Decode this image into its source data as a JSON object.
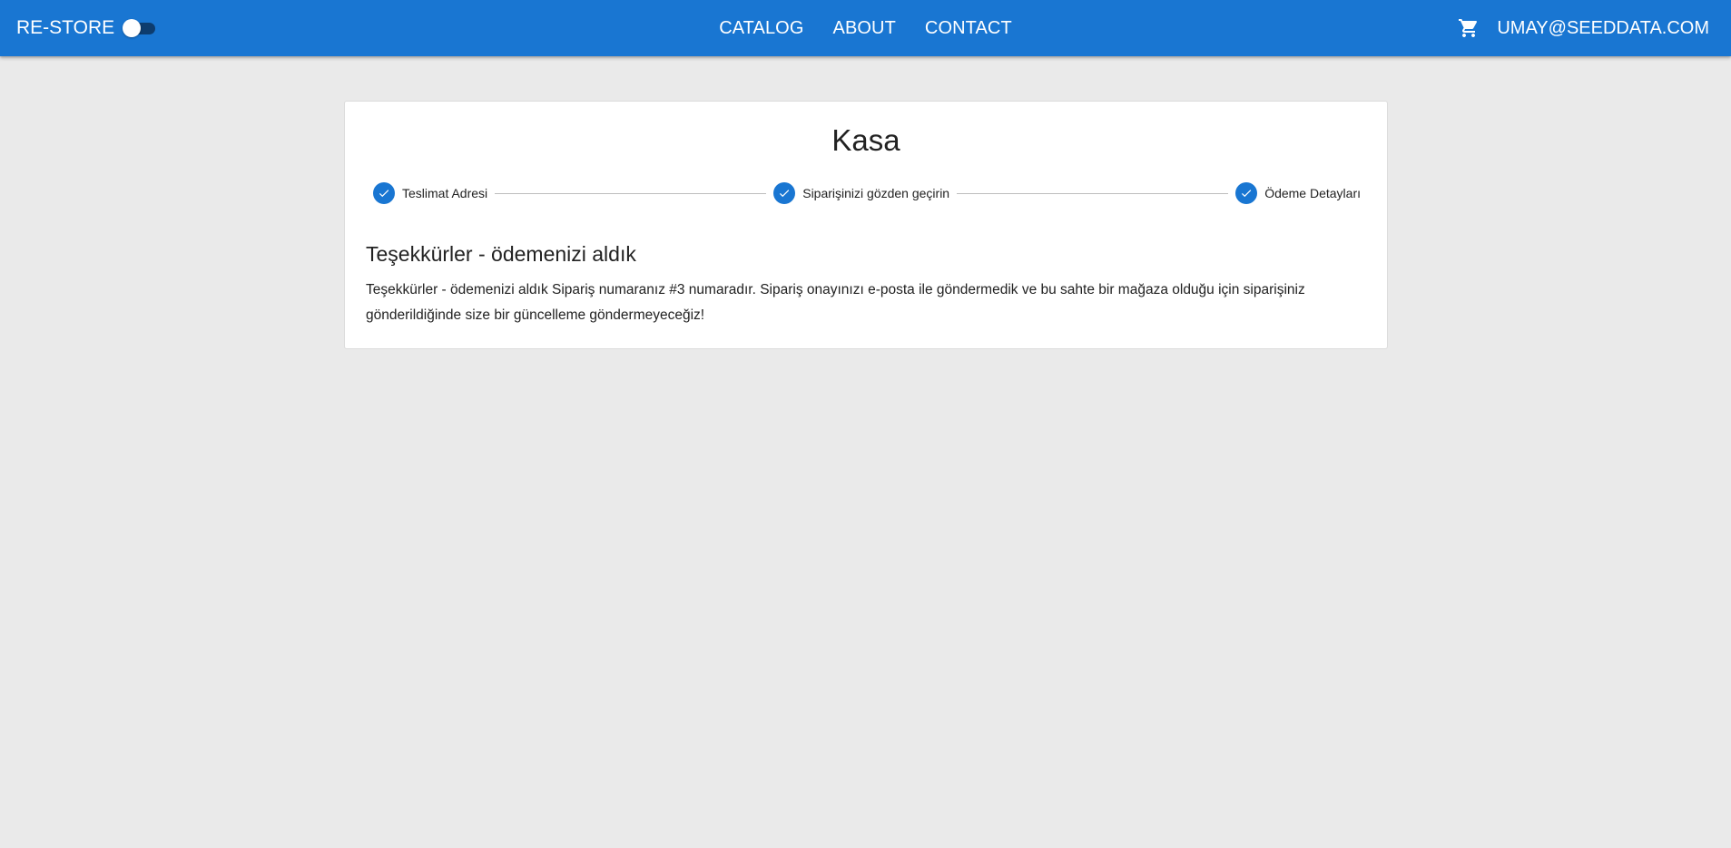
{
  "header": {
    "brand": "RE-STORE",
    "theme_toggle_on": false,
    "nav": [
      {
        "label": "CATALOG"
      },
      {
        "label": "ABOUT"
      },
      {
        "label": "CONTACT"
      }
    ],
    "cart_icon": "shopping-cart-icon",
    "user_email": "UMAY@SEEDDATA.COM"
  },
  "checkout": {
    "title": "Kasa",
    "steps": [
      {
        "label": "Teslimat Adresi",
        "icon": "check-circle-icon",
        "completed": true
      },
      {
        "label": "Siparişinizi gözden geçirin",
        "icon": "check-circle-icon",
        "completed": true
      },
      {
        "label": "Ödeme Detayları",
        "icon": "check-circle-icon",
        "completed": true
      }
    ],
    "confirmation_title": "Teşekkürler - ödemenizi aldık",
    "confirmation_message": "Teşekkürler - ödemenizi aldık Sipariş numaranız #3 numaradır. Sipariş onayınızı e-posta ile göndermedik ve bu sahte bir mağaza olduğu için siparişiniz gönderildiğinde size bir güncelleme göndermeyeceğiz!"
  },
  "colors": {
    "primary": "#1976d2",
    "background": "#eaeaea",
    "paper": "#ffffff",
    "text": "#222222"
  }
}
